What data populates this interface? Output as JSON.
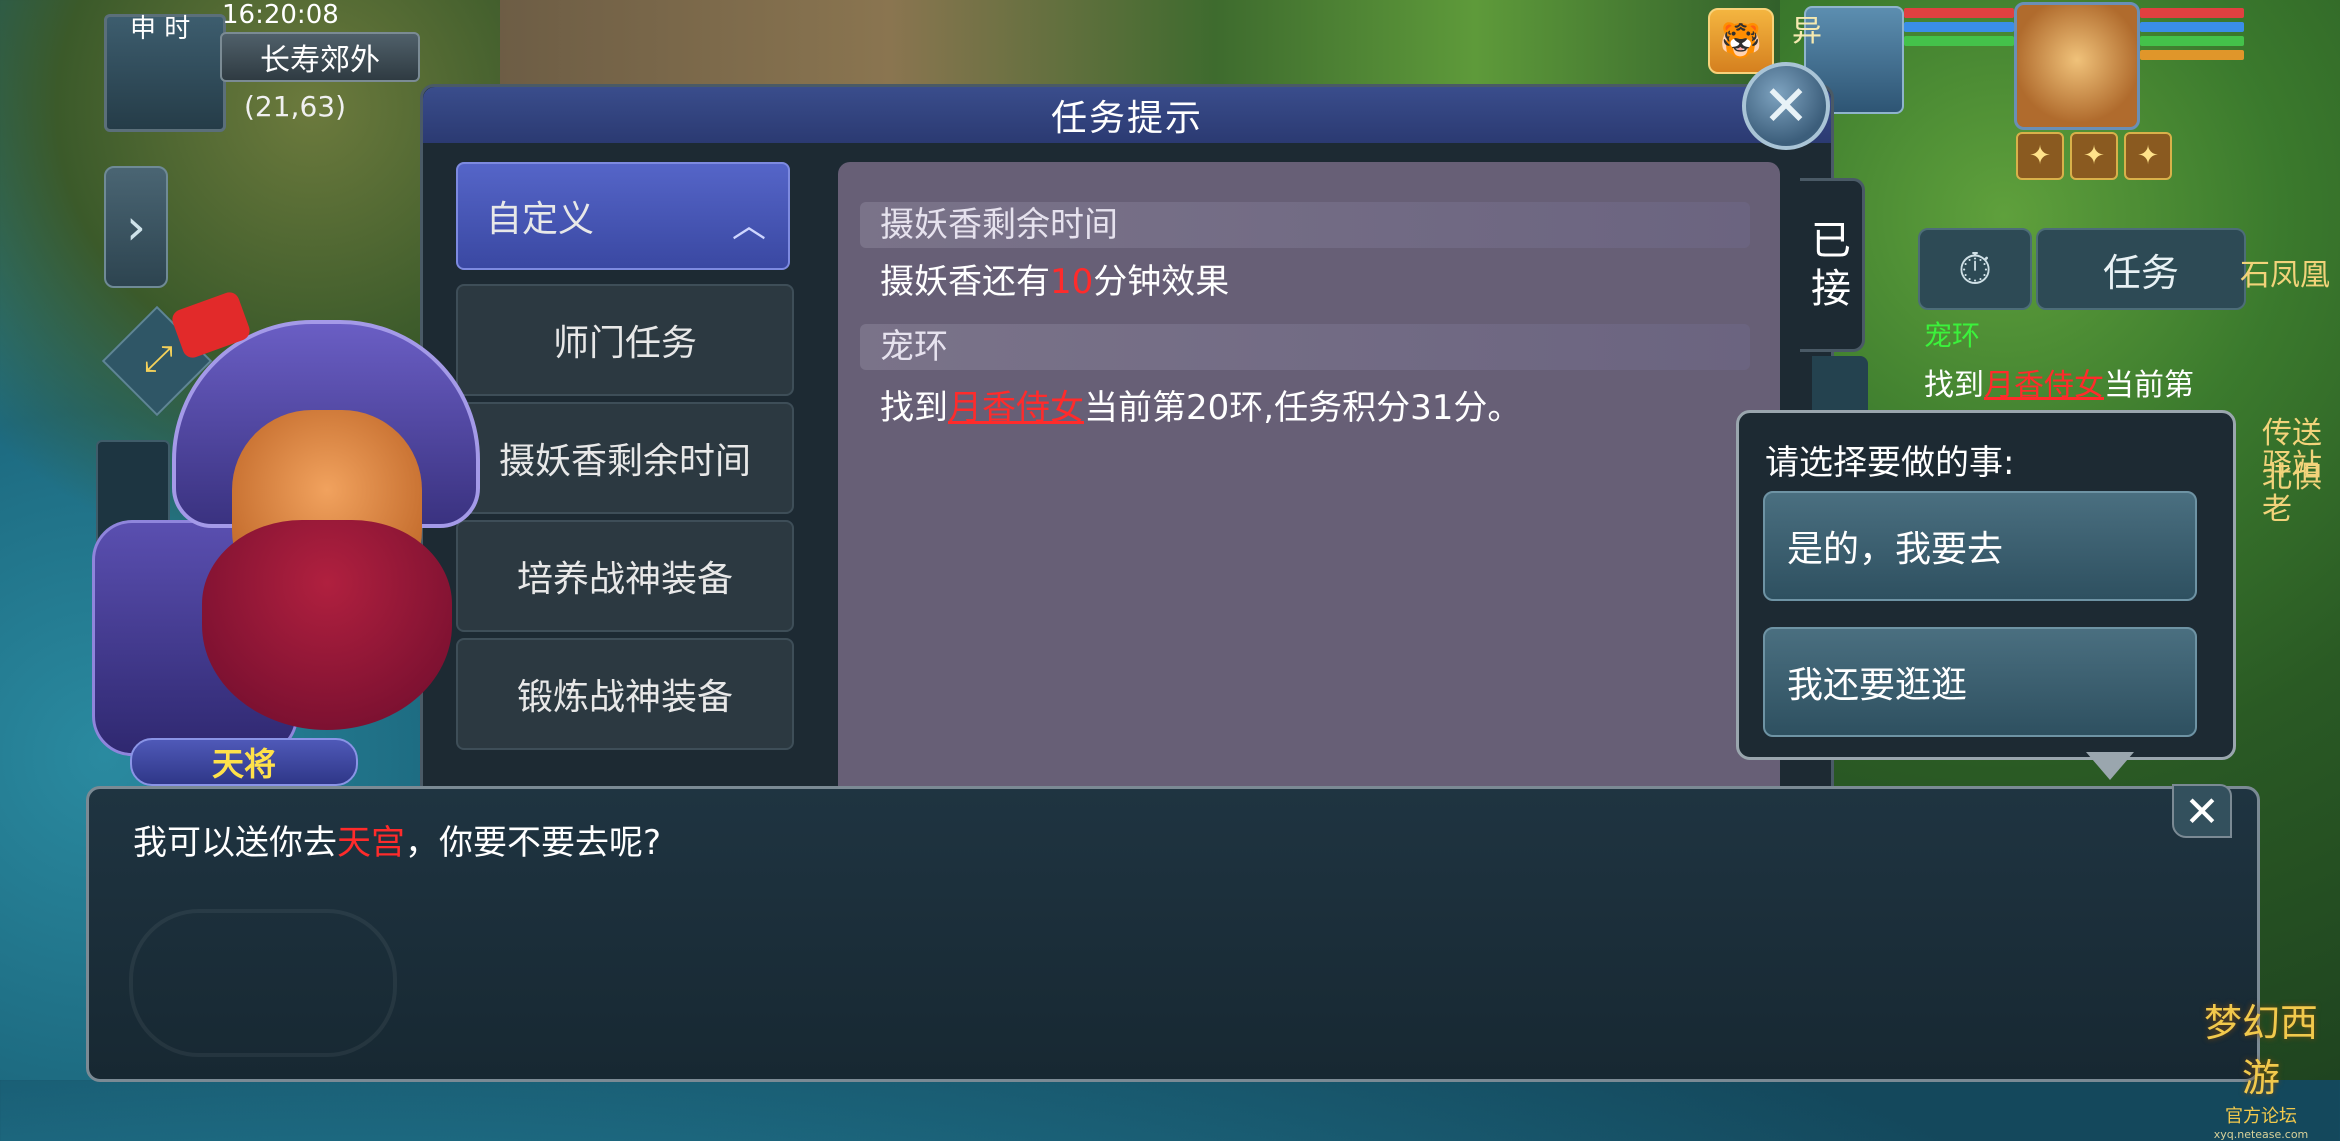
{
  "hud": {
    "time_label": "申 时",
    "time": "16:20:08",
    "location": "长寿郊外",
    "coords": "(21,63)",
    "pet_label": "异",
    "task_button": "任务"
  },
  "task_window": {
    "title": "任务提示",
    "tab_accepted": [
      "已",
      "接"
    ],
    "categories": [
      {
        "label": "自定义"
      },
      {
        "label": "师门任务"
      },
      {
        "label": "摄妖香剩余时间"
      },
      {
        "label": "培养战神装备"
      },
      {
        "label": "锻炼战神装备"
      }
    ],
    "sections": [
      {
        "heading": "摄妖香剩余时间",
        "line_prefix": "摄妖香还有",
        "line_highlight": "10",
        "line_suffix": "分钟效果"
      },
      {
        "heading": "宠环",
        "line_prefix": "找到",
        "line_link": "月香侍女",
        "line_suffix": "当前第20环,任务积分31分。"
      }
    ]
  },
  "tracker": {
    "title": "宠环",
    "line_prefix": "找到",
    "line_link": "月香侍女",
    "line_suffix": "当前第"
  },
  "background_labels": {
    "top_right_fragment": "石凤凰",
    "side_fragment_1": "传送北俱",
    "side_fragment_2": "驿站老"
  },
  "choice": {
    "prompt": "请选择要做的事:",
    "options": [
      "是的，我要去",
      "我还要逛逛"
    ]
  },
  "npc": {
    "name": "天将"
  },
  "dialog": {
    "prefix": "我可以送你去",
    "highlight": "天宫",
    "suffix": "，你要不要去呢?",
    "close_glyph": "✕"
  },
  "watermark": {
    "logo": "梦幻西游",
    "sub": "官方论坛",
    "url": "xyq.netease.com"
  },
  "colors": {
    "highlight_red": "#ff2b2b",
    "tracker_green": "#3bf23b",
    "npc_name_yellow": "#ffe14a",
    "hp_red": "#e04040",
    "mp_blue": "#3a8ee8",
    "sp_green": "#44c24a",
    "exp_orange": "#e0962a"
  },
  "icons": {
    "close": "close-icon",
    "expand": "expand-arrows-icon",
    "side_toggle": "chevron-right-icon",
    "timer": "stopwatch-icon"
  }
}
